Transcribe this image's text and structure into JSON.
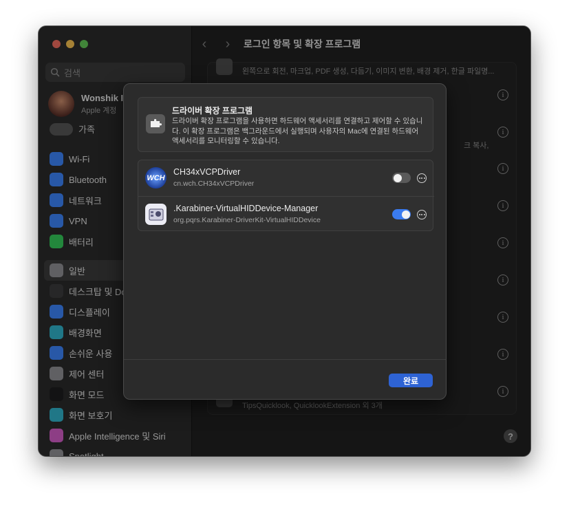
{
  "window": {
    "title": "로그인 항목 및 확장 프로그램",
    "traffic_lights": {
      "close": "#ec6a5e",
      "minimize": "#f4bf4f",
      "zoom": "#61c554"
    }
  },
  "sidebar": {
    "search_placeholder": "검색",
    "account": {
      "name": "Wonshik I",
      "subtitle": "Apple 계정"
    },
    "family_label": "가족",
    "group1": [
      {
        "label": "Wi-Fi",
        "icon": "wifi-icon",
        "color": "#3b82f6"
      },
      {
        "label": "Bluetooth",
        "icon": "bluetooth-icon",
        "color": "#3b82f6"
      },
      {
        "label": "네트워크",
        "icon": "globe-icon",
        "color": "#3b82f6"
      },
      {
        "label": "VPN",
        "icon": "vpn-icon",
        "color": "#3b82f6"
      },
      {
        "label": "배터리",
        "icon": "battery-icon",
        "color": "#34c759"
      }
    ],
    "group2": [
      {
        "label": "일반",
        "icon": "gear-icon",
        "color": "#8e8e93",
        "selected": true
      },
      {
        "label": "데스크탑 및 Dock",
        "icon": "dock-icon",
        "color": "#3a3a3c"
      },
      {
        "label": "디스플레이",
        "icon": "sun-icon",
        "color": "#3b82f6"
      },
      {
        "label": "배경화면",
        "icon": "wallpaper-icon",
        "color": "#30b0c7"
      },
      {
        "label": "손쉬운 사용",
        "icon": "accessibility-icon",
        "color": "#3b82f6"
      },
      {
        "label": "제어 센터",
        "icon": "control-center-icon",
        "color": "#8e8e93"
      },
      {
        "label": "화면 모드",
        "icon": "appearance-icon",
        "color": "#1c1c1e"
      },
      {
        "label": "화면 보호기",
        "icon": "screensaver-icon",
        "color": "#30b0c7"
      },
      {
        "label": "Apple Intelligence 및 Siri",
        "icon": "siri-icon",
        "color": "#d05cc5"
      },
      {
        "label": "Spotlight",
        "icon": "spotlight-icon",
        "color": "#8e8e93"
      }
    ]
  },
  "main": {
    "row_top_text": "왼쪽으로 회전, 마크업, PDF 생성, 다듬기, 이미지 변환, 배경 제거, 한글 파일명...",
    "row_mid_text": "크 복사,",
    "row_bottom_text": "TipsQuicklook, QuicklookExtension 외 3개",
    "info_button_count": 9
  },
  "sheet": {
    "header_title": "드라이버 확장 프로그램",
    "header_desc": "드라이버 확장 프로그램을 사용하면 하드웨어 액세서리를 연결하고 제어할 수 있습니다. 이 확장 프로그램은 백그라운드에서 실행되며 사용자의 Mac에 연결된 하드웨어 액세서리를 모니터링할 수 있습니다.",
    "extensions": [
      {
        "name": "CH34xVCPDriver",
        "bundle_id": "cn.wch.CH34xVCPDriver",
        "enabled": false,
        "icon": "wch-logo-icon"
      },
      {
        "name": ".Karabiner-VirtualHIDDevice-Manager",
        "bundle_id": "org.pqrs.Karabiner-DriverKit-VirtualHIDDevice",
        "enabled": true,
        "icon": "karabiner-icon"
      }
    ],
    "done_label": "완료",
    "accent": "#2e63d4",
    "toggle_on_color": "#3a7bf0",
    "toggle_off_color": "#5a5a5a"
  }
}
